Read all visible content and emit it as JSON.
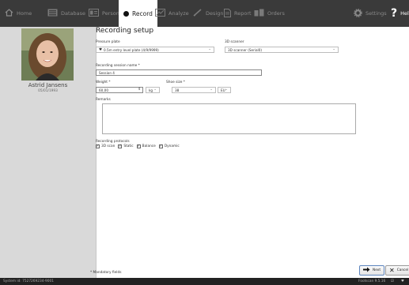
{
  "nav": {
    "home": "Home",
    "database": "Database",
    "person": "Person",
    "record": "Record",
    "analyze": "Analyze",
    "design": "Design",
    "report": "Report",
    "orders": "Orders",
    "settings": "Settings",
    "help": "Help"
  },
  "profile": {
    "name": "Astrid Jansens",
    "dob": "05/01/1993"
  },
  "form": {
    "title": "Recording setup",
    "pressure_plate_label": "Pressure plate",
    "pressure_plate_value": "0.5m entry level plate (4/9/9999)",
    "scanner_label": "3D scanner",
    "scanner_value": "3D scanner (Serial0)",
    "session_label": "Recording session name *",
    "session_value": "Session 4",
    "weight_label": "Weight *",
    "weight_value": "60,00",
    "weight_unit": "kg",
    "shoe_label": "Shoe size *",
    "shoe_value": "38",
    "shoe_unit": "EU",
    "remarks_label": "Remarks",
    "protocols_label": "Recording protocols",
    "protocols": [
      "3D scan",
      "Static",
      "Balance",
      "Dynamic"
    ],
    "mandatory_note": "* Mandatory fields"
  },
  "buttons": {
    "next": "Next",
    "cancel": "Cancel"
  },
  "status": {
    "system_id": "System id: 7527269234-9001",
    "version": "Footscan 9.5.16"
  }
}
